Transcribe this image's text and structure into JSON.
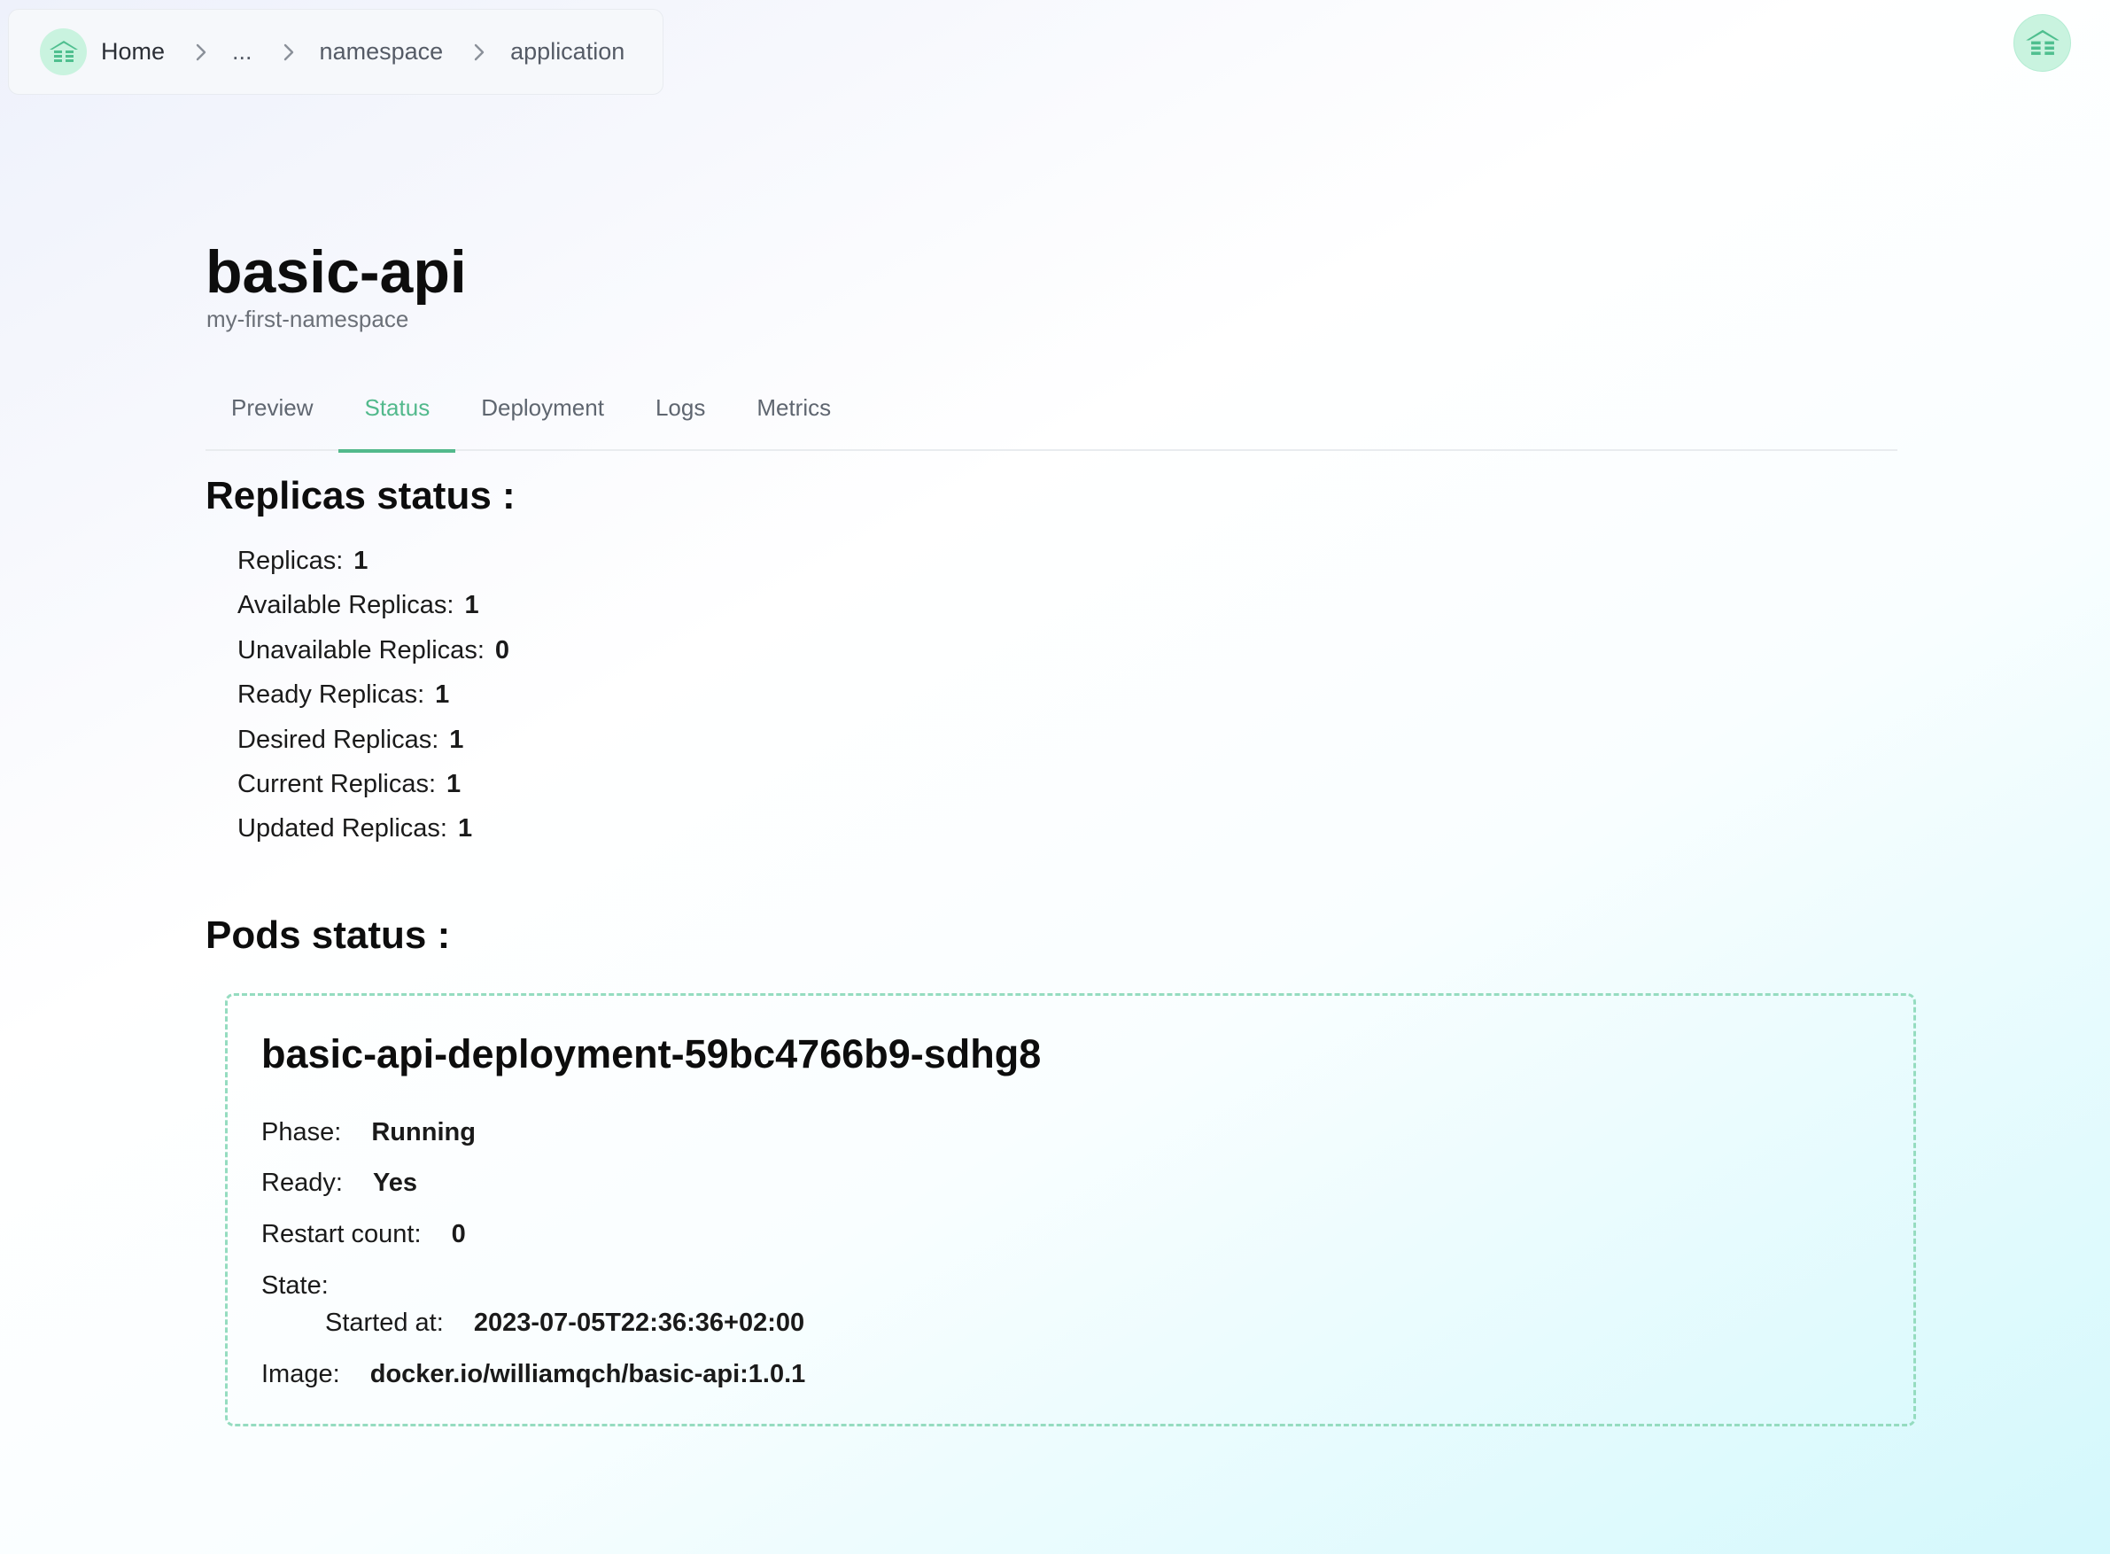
{
  "breadcrumb": {
    "home": "Home",
    "ellipsis": "...",
    "namespace": "namespace",
    "application": "application"
  },
  "app": {
    "title": "basic-api",
    "namespace": "my-first-namespace"
  },
  "tabs": [
    {
      "label": "Preview",
      "active": false
    },
    {
      "label": "Status",
      "active": true
    },
    {
      "label": "Deployment",
      "active": false
    },
    {
      "label": "Logs",
      "active": false
    },
    {
      "label": "Metrics",
      "active": false
    }
  ],
  "replicas": {
    "heading": "Replicas status :",
    "items": [
      {
        "label": "Replicas:",
        "value": "1"
      },
      {
        "label": "Available Replicas:",
        "value": "1"
      },
      {
        "label": "Unavailable Replicas:",
        "value": "0"
      },
      {
        "label": "Ready Replicas:",
        "value": "1"
      },
      {
        "label": "Desired Replicas:",
        "value": "1"
      },
      {
        "label": "Current Replicas:",
        "value": "1"
      },
      {
        "label": "Updated Replicas:",
        "value": "1"
      }
    ]
  },
  "pods": {
    "heading": "Pods status :",
    "pod": {
      "name": "basic-api-deployment-59bc4766b9-sdhg8",
      "phase_label": "Phase:",
      "phase": "Running",
      "ready_label": "Ready:",
      "ready": "Yes",
      "restart_label": "Restart count:",
      "restart_count": "0",
      "state_label": "State:",
      "started_label": "Started at:",
      "started_at": "2023-07-05T22:36:36+02:00",
      "image_label": "Image:",
      "image": "docker.io/williamqch/basic-api:1.0.1"
    }
  },
  "colors": {
    "accent": "#52b98c",
    "logo_bg": "#c9f3df",
    "card_border": "#95dcc0"
  },
  "icons": {
    "logo": "house-logo-icon",
    "separator": "chevron-right-icon"
  }
}
